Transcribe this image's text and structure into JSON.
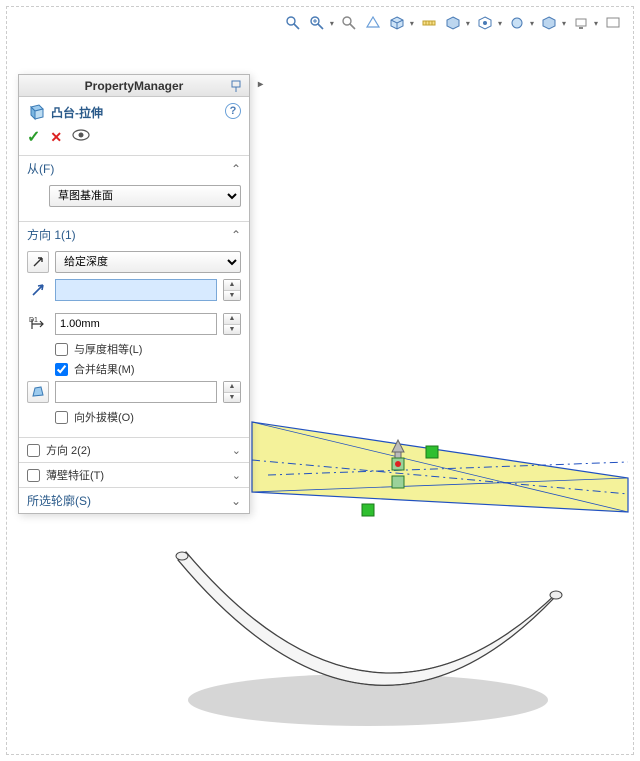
{
  "panel": {
    "header": "PropertyManager",
    "feature_title": "凸台-拉伸",
    "sections": {
      "from": {
        "label": "从(F)",
        "option": "草图基准面"
      },
      "dir1": {
        "label": "方向 1(1)",
        "end_condition": "给定深度",
        "depth_value": "",
        "dim_value": "1.00mm",
        "chk_thickness": "与厚度相等(L)",
        "chk_merge": "合并结果(M)",
        "chk_draft": "向外拔模(O)"
      },
      "dir2": {
        "label": "方向 2(2)"
      },
      "thin": {
        "label": "薄壁特征(T)"
      },
      "contours": {
        "label": "所选轮廓(S)"
      }
    }
  }
}
